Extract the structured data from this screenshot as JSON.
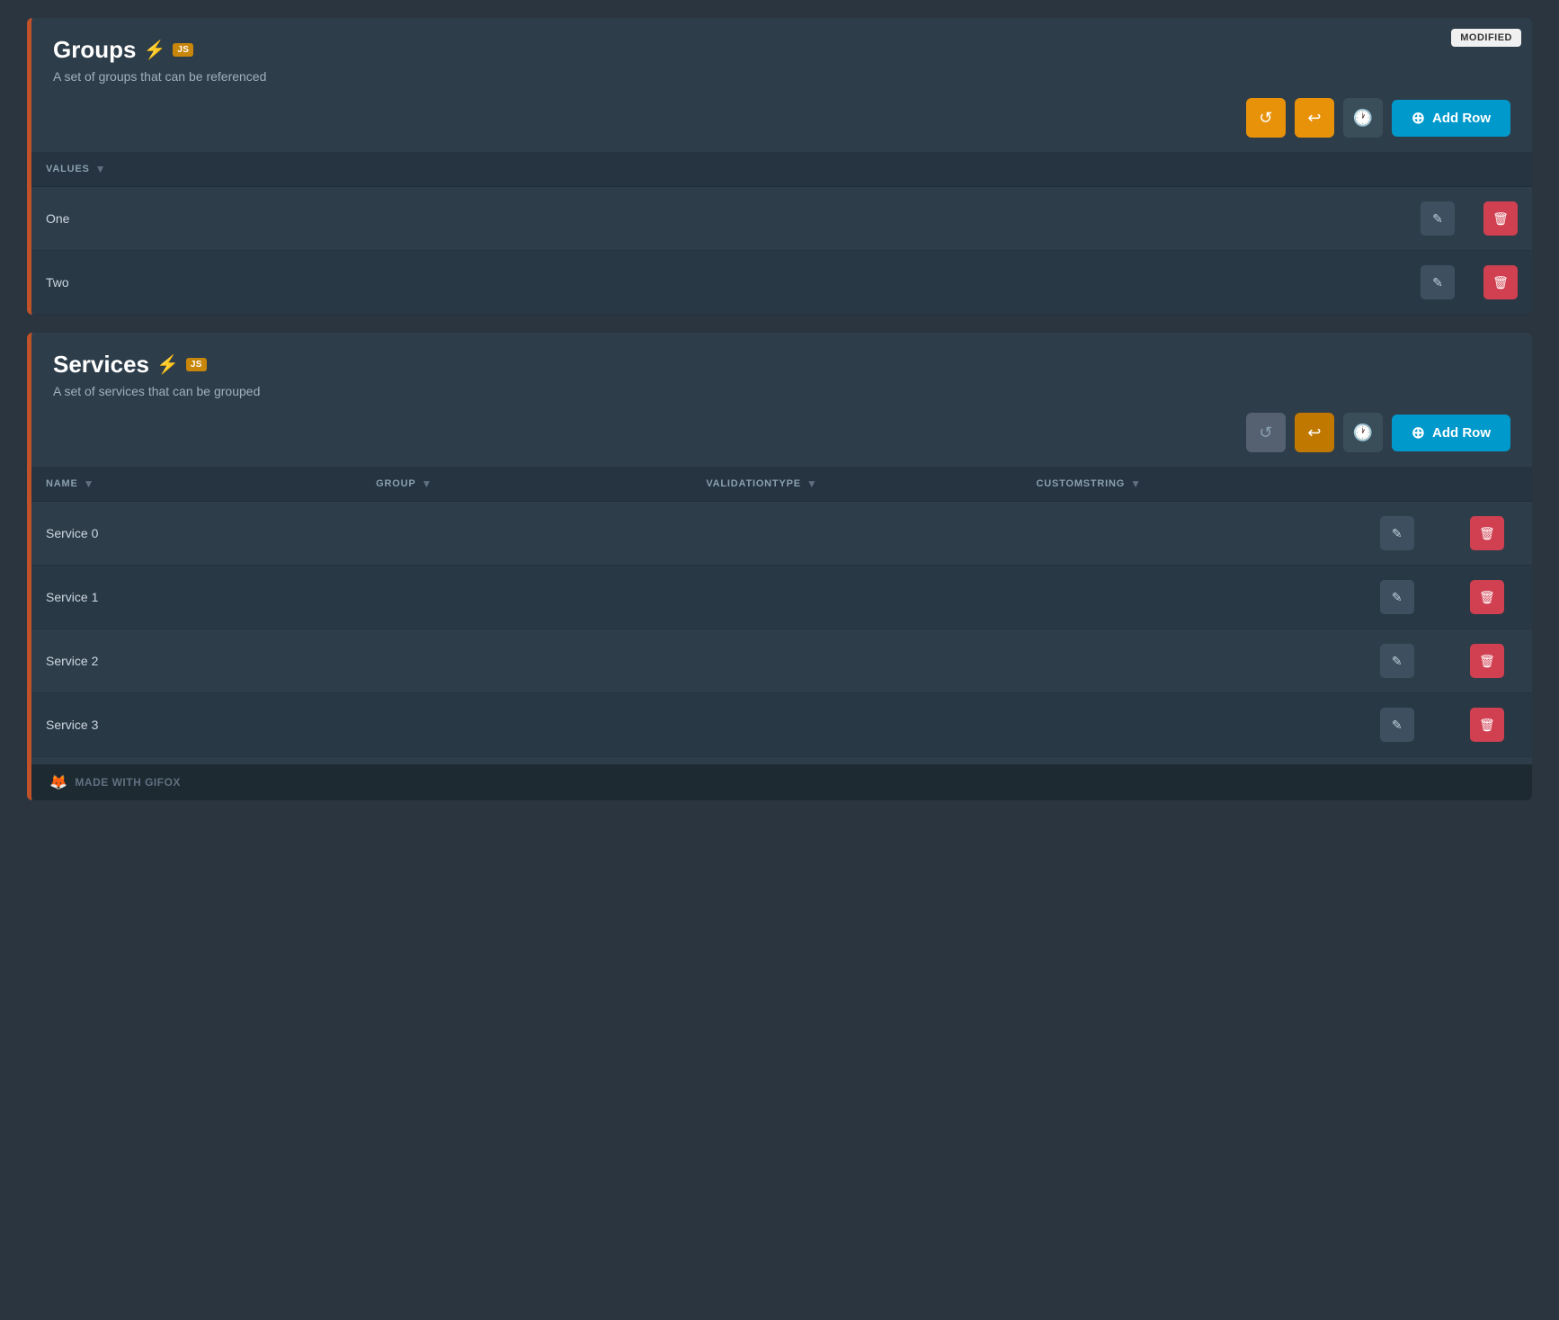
{
  "groups_section": {
    "title": "Groups",
    "description": "A set of groups that can be referenced",
    "modified_badge": "MODIFIED",
    "js_badge": "JS",
    "add_row_label": "Add Row",
    "table": {
      "columns": [
        {
          "key": "values",
          "label": "VALUES"
        }
      ],
      "rows": [
        {
          "value": "One"
        },
        {
          "value": "Two"
        }
      ]
    },
    "buttons": {
      "refresh": "↺",
      "history": "↩",
      "clock": "🕐"
    }
  },
  "services_section": {
    "title": "Services",
    "description": "A set of services that can be grouped",
    "js_badge": "JS",
    "add_row_label": "Add Row",
    "table": {
      "columns": [
        {
          "key": "name",
          "label": "NAME"
        },
        {
          "key": "group",
          "label": "GROUP"
        },
        {
          "key": "validationtype",
          "label": "VALIDATIONTYPE"
        },
        {
          "key": "customstring",
          "label": "CUSTOMSTRING"
        }
      ],
      "rows": [
        {
          "name": "Service 0",
          "group": "",
          "validationtype": "",
          "customstring": ""
        },
        {
          "name": "Service 1",
          "group": "",
          "validationtype": "",
          "customstring": ""
        },
        {
          "name": "Service 2",
          "group": "",
          "validationtype": "",
          "customstring": ""
        },
        {
          "name": "Service 3",
          "group": "",
          "validationtype": "",
          "customstring": ""
        }
      ]
    }
  },
  "footer": {
    "label": "MADE WITH GIFOX"
  },
  "icons": {
    "bolt": "⚡",
    "plus_circle": "⊕",
    "filter": "▼",
    "edit": "✎",
    "trash": "🗑",
    "refresh": "↺",
    "undo": "↩",
    "clock": "🕐",
    "fox": "🦊"
  }
}
